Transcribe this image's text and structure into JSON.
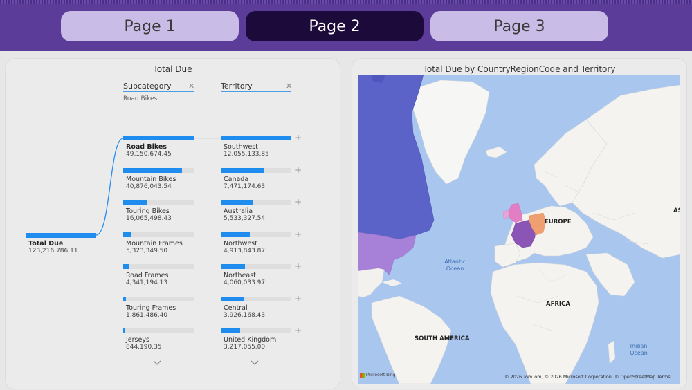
{
  "tabs": [
    {
      "label": "Page 1",
      "active": false
    },
    {
      "label": "Page 2",
      "active": true
    },
    {
      "label": "Page 3",
      "active": false
    }
  ],
  "decomp": {
    "title": "Total Due",
    "root": {
      "label": "Total Due",
      "value": "123,216,786.11"
    },
    "col1": {
      "header": "Subcategory",
      "filter": "Road Bikes",
      "items": [
        {
          "label": "Road Bikes",
          "value": "49,150,674.45",
          "fraction": 1.0
        },
        {
          "label": "Mountain Bikes",
          "value": "40,876,043.54",
          "fraction": 0.83
        },
        {
          "label": "Touring Bikes",
          "value": "16,065,498.43",
          "fraction": 0.33
        },
        {
          "label": "Mountain Frames",
          "value": "5,323,349.50",
          "fraction": 0.11
        },
        {
          "label": "Road Frames",
          "value": "4,341,194.13",
          "fraction": 0.09
        },
        {
          "label": "Touring Frames",
          "value": "1,861,486.40",
          "fraction": 0.04
        },
        {
          "label": "Jerseys",
          "value": "844,190.35",
          "fraction": 0.02
        }
      ]
    },
    "col2": {
      "header": "Territory",
      "items": [
        {
          "label": "Southwest",
          "value": "12,055,133.85",
          "fraction": 1.0
        },
        {
          "label": "Canada",
          "value": "7,471,174.63",
          "fraction": 0.62
        },
        {
          "label": "Australia",
          "value": "5,533,327.54",
          "fraction": 0.46
        },
        {
          "label": "Northwest",
          "value": "4,913,843.87",
          "fraction": 0.41
        },
        {
          "label": "Northeast",
          "value": "4,060,033.97",
          "fraction": 0.34
        },
        {
          "label": "Central",
          "value": "3,926,168.43",
          "fraction": 0.33
        },
        {
          "label": "United Kingdom",
          "value": "3,217,055.00",
          "fraction": 0.27
        }
      ]
    }
  },
  "map": {
    "title": "Total Due by CountryRegionCode and Territory",
    "labels": {
      "europe": "EUROPE",
      "africa": "AFRICA",
      "south_america": "SOUTH AMERICA",
      "asia_partial": "AS",
      "atlantic": "Atlantic Ocean",
      "indian": "Indian Ocean"
    },
    "bing": "Microsoft Bing",
    "attribution": "© 2026 TomTom, © 2026 Microsoft Corporation, © OpenStreetMap  Terms",
    "colors": {
      "ocean": "#a9c6ef",
      "land": "#f4f3f0",
      "canada": "#5b63c8",
      "usa": "#a780d8",
      "uk": "#e27fc4",
      "france": "#8a55b5",
      "germany": "#f0a070"
    }
  },
  "colors": {
    "header": "#5b3c99",
    "tab_active": "#1c0a3a",
    "tab_inactive": "#c9bde8",
    "bar": "#1f8df0"
  }
}
